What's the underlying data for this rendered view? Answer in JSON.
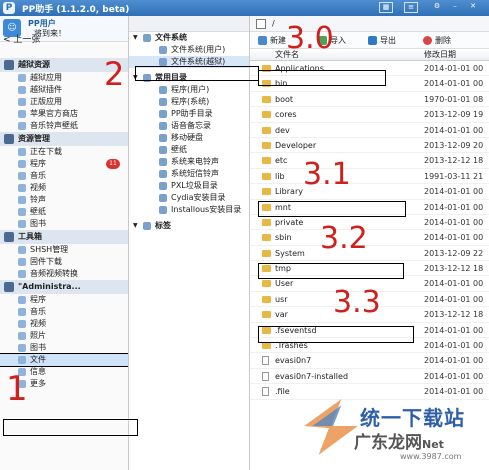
{
  "window": {
    "title": "PP助手 (1.1.2.0, beta)",
    "logo_glyph": "P"
  },
  "user": {
    "name": "PP用户",
    "subtitle": "将到来！",
    "back_label": "< 上一张"
  },
  "sidebar": {
    "sections": [
      {
        "label": "越狱资源",
        "items": [
          "越狱应用",
          "越狱插件",
          "正版应用",
          "苹果官方商店",
          "音乐铃声壁纸"
        ]
      },
      {
        "label": "资源管理",
        "items": [
          "正在下载",
          "程序",
          "音乐",
          "视频",
          "铃声",
          "壁纸",
          "图书"
        ],
        "badge": {
          "item": "程序",
          "count": "11"
        }
      },
      {
        "label": "工具箱",
        "items": [
          "SHSH管理",
          "固件下载",
          "音频视频转换"
        ]
      },
      {
        "label": "\"Administra...",
        "items": [
          "程序",
          "音乐",
          "视频",
          "照片",
          "图书",
          "文件",
          "信息",
          "更多"
        ]
      }
    ],
    "selected_item": "文件"
  },
  "tree": {
    "file_system": {
      "label": "文件系统",
      "children": [
        "文件系统(用户)",
        "文件系统(越狱)"
      ]
    },
    "common": {
      "label": "常用目录",
      "children": [
        "程序(用户)",
        "程序(系统)",
        "PP助手目录",
        "语音备忘录",
        "移动硬盘",
        "壁纸",
        "系统来电铃声",
        "系统短信铃声",
        "PXL垃圾目录",
        "Cydia安装目录",
        "Installous安装目录"
      ]
    },
    "bookmarks": {
      "label": "标签"
    }
  },
  "main": {
    "path": "/",
    "toolbar": {
      "new": "新建",
      "import": "导入",
      "export": "导出",
      "delete": "删除"
    },
    "columns": {
      "name": "文件名",
      "modified": "修改日期"
    },
    "files": [
      {
        "name": "Applications",
        "date": "2014-01-01 00",
        "type": "folder"
      },
      {
        "name": "bin",
        "date": "2014-01-01 00",
        "type": "folder"
      },
      {
        "name": "boot",
        "date": "1970-01-01 08",
        "type": "folder"
      },
      {
        "name": "cores",
        "date": "2013-12-09 19",
        "type": "folder"
      },
      {
        "name": "dev",
        "date": "2014-01-01 00",
        "type": "folder"
      },
      {
        "name": "Developer",
        "date": "2013-12-09 20",
        "type": "folder"
      },
      {
        "name": "etc",
        "date": "2013-12-12 18",
        "type": "folder"
      },
      {
        "name": "lib",
        "date": "1991-03-11 21",
        "type": "folder"
      },
      {
        "name": "Library",
        "date": "2014-01-01 00",
        "type": "folder"
      },
      {
        "name": "mnt",
        "date": "2014-01-01 00",
        "type": "folder"
      },
      {
        "name": "private",
        "date": "2014-01-01 00",
        "type": "folder"
      },
      {
        "name": "sbin",
        "date": "2014-01-01 00",
        "type": "folder"
      },
      {
        "name": "System",
        "date": "2013-12-09 22",
        "type": "folder"
      },
      {
        "name": "tmp",
        "date": "2013-12-12 18",
        "type": "folder"
      },
      {
        "name": "User",
        "date": "2014-01-01 00",
        "type": "folder"
      },
      {
        "name": "usr",
        "date": "2014-01-01 00",
        "type": "folder"
      },
      {
        "name": "var",
        "date": "2013-12-12 18",
        "type": "folder"
      },
      {
        "name": ".fseventsd",
        "date": "2014-01-01 00",
        "type": "folder"
      },
      {
        "name": ".Trashes",
        "date": "2014-01-01 00",
        "type": "folder"
      },
      {
        "name": "evasi0n7",
        "date": "2014-01-01 00",
        "type": "file"
      },
      {
        "name": "evasi0n7-installed",
        "date": "2014-01-01 00",
        "type": "file"
      },
      {
        "name": ".file",
        "date": "2014-01-01 00",
        "type": "file"
      }
    ]
  },
  "annotations": {
    "step1": "1",
    "step2": "2",
    "step30": "3.0",
    "step31": "3.1",
    "step32": "3.2",
    "step33": "3.3",
    "color": "#d0201d"
  },
  "watermark": {
    "line1": "统一下载站",
    "line2": "广东龙网",
    "line2_suffix": "Net",
    "url": "www.3987.com"
  }
}
